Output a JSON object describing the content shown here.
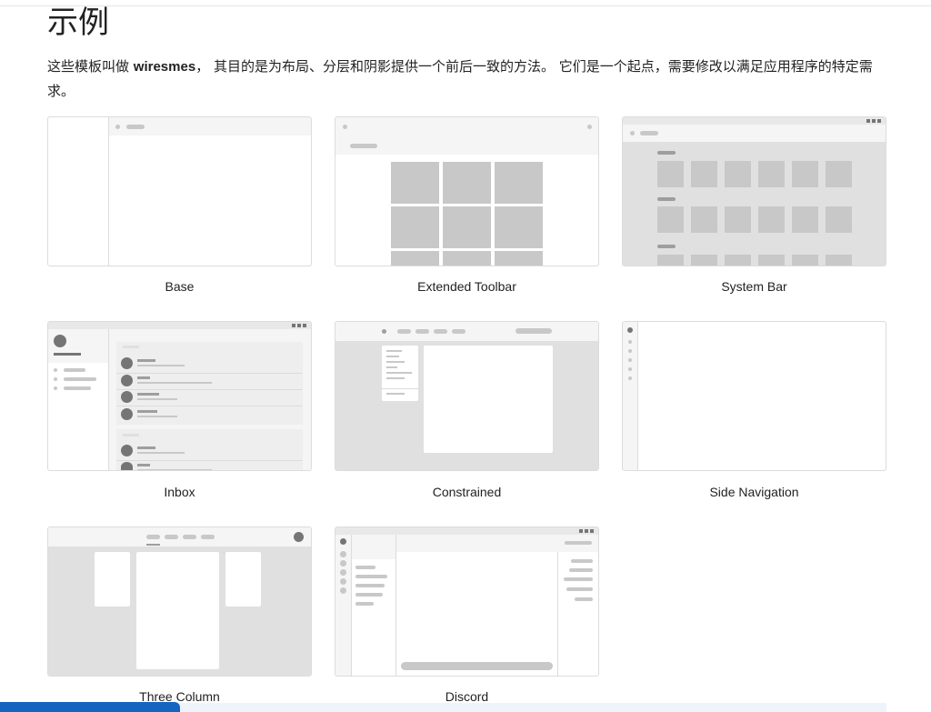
{
  "page": {
    "title": "示例",
    "intro_before": "这些模板叫做 ",
    "intro_bold": "wiresmes",
    "intro_after": "， 其目的是为布局、分层和阴影提供一个前后一致的方法。 它们是一个起点，需要修改以满足应用程序的特定需求。"
  },
  "templates": [
    {
      "id": "base",
      "label": "Base"
    },
    {
      "id": "extended-toolbar",
      "label": "Extended Toolbar"
    },
    {
      "id": "system-bar",
      "label": "System Bar"
    },
    {
      "id": "inbox",
      "label": "Inbox"
    },
    {
      "id": "constrained",
      "label": "Constrained"
    },
    {
      "id": "side-navigation",
      "label": "Side Navigation"
    },
    {
      "id": "three-column",
      "label": "Three Column"
    },
    {
      "id": "discord",
      "label": "Discord"
    }
  ],
  "colors": {
    "wire_dark": "#9e9e9e",
    "wire_mid": "#c8c8c8",
    "wire_light": "#e0e0e0",
    "wire_bg": "#f5f5f5",
    "accent": "#1565c0"
  }
}
